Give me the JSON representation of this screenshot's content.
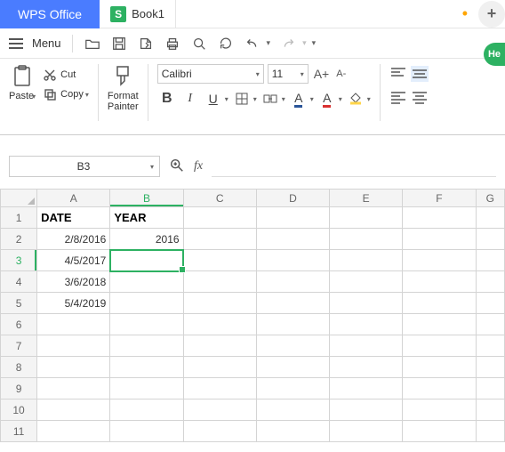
{
  "app": {
    "name": "WPS Office"
  },
  "tab": {
    "icon_letter": "S",
    "title": "Book1",
    "modified_dot": "•",
    "add": "+"
  },
  "help": {
    "label": "He"
  },
  "menu": {
    "label": "Menu"
  },
  "ribbon": {
    "paste": "Paste",
    "cut": "Cut",
    "copy": "Copy",
    "format_painter_l1": "Format",
    "format_painter_l2": "Painter",
    "font_name": "Calibri",
    "font_size": "11",
    "Aplus": "A+",
    "Aminus": "A-",
    "bold": "B",
    "italic": "I",
    "underline": "U",
    "fontA1": "A",
    "fontA2": "A"
  },
  "refbar": {
    "cell": "B3",
    "fx": "fx"
  },
  "sheet": {
    "cols": [
      "A",
      "B",
      "C",
      "D",
      "E",
      "F",
      "G"
    ],
    "selected_col": "B",
    "selected_row": "3",
    "rows": [
      "1",
      "2",
      "3",
      "4",
      "5",
      "6",
      "7",
      "8",
      "9",
      "10",
      "11"
    ],
    "headers": {
      "A": "DATE",
      "B": "YEAR"
    },
    "data": [
      {
        "A": "2/8/2016",
        "B": "2016"
      },
      {
        "A": "4/5/2017",
        "B": ""
      },
      {
        "A": "3/6/2018",
        "B": ""
      },
      {
        "A": "5/4/2019",
        "B": ""
      }
    ]
  }
}
